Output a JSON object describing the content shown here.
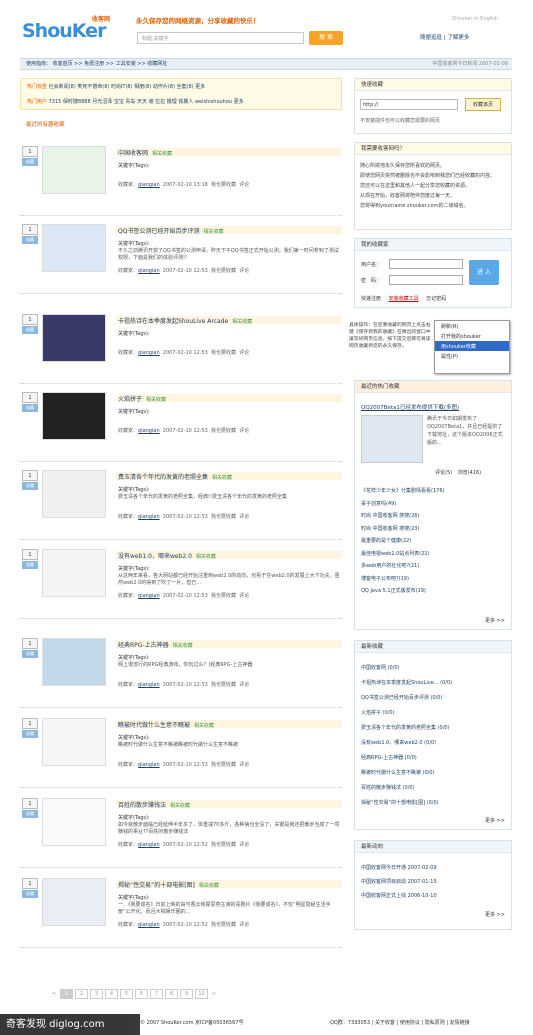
{
  "header": {
    "logo_text": "ShouKer",
    "logo_cn": "收客网",
    "slogan": "永久保存您的网络资源，分享收藏的快乐！",
    "search_placeholder": "标题,关键字",
    "search_btn": "搜 索",
    "english": "Shouker in English",
    "links": "随便逛逛 | 了解更多"
  },
  "nav": {
    "breadcrumb": "使用指南： 收客首页 >> 免费注册 >> 工具安装 >> 收藏网址",
    "right": "中国收客网今日新闻 2007-02-09"
  },
  "tags": {
    "hot_label": "热门标签",
    "hot": "社会新闻(8) 笑死不偿命(8) 时尚IT(8) 相册(8) 动作片(8) 全套(8) 更多",
    "users_label": "热门用户",
    "users": "7315 保时捷8888 月光沼泽 宝宝 青岛 天天 谢 拉拉 摄理 铁翼人 weishishouhou 更多"
  },
  "recent": {
    "title": "最近的有趣收藏"
  },
  "items": [
    {
      "count": "1",
      "badge": "收藏",
      "title": "中国收客网",
      "rel": "相关收藏",
      "kw": "关键字(Tags):",
      "desc": "",
      "user": "qiangian",
      "date": "2007-02-10 13:18",
      "a1": "我也要收藏",
      "a2": "评论"
    },
    {
      "count": "1",
      "badge": "收藏",
      "title": "QQ书签公测已经开始百步评测",
      "rel": "相关收藏",
      "kw": "关键字(Tags):",
      "desc": "不久之前腾讯开放了QQ书签的公测申请，昨天下午QQ书签正式开始公测，我们第一时间拿到了测试权限，下面是我们的体验评测!!",
      "user": "qiangian",
      "date": "2007-02-10 12:53",
      "a1": "我也要收藏",
      "a2": "评论"
    },
    {
      "count": "1",
      "badge": "收藏",
      "title": "卡祖热诗在本季度发起ShouLive Arcade",
      "rel": "相关收藏",
      "kw": "关键字(Tags):",
      "desc": "",
      "user": "qiangian",
      "date": "2007-02-10 12:53",
      "a1": "我也要收藏",
      "a2": "评论"
    },
    {
      "count": "1",
      "badge": "收藏",
      "title": "火焰拼子",
      "rel": "相关收藏",
      "kw": "关键字(Tags):",
      "desc": "",
      "user": "qiangian",
      "date": "2007-02-10 12:53",
      "a1": "我也要收藏",
      "a2": "评论"
    },
    {
      "count": "1",
      "badge": "收藏",
      "title": "费玉清各个年代的发黄的老照全集",
      "rel": "相关收藏",
      "kw": "关键字(Tags):",
      "desc": "费玉清各个年代的发黄的老照全集，经典!!费玉清各个年代的发黄的老照全集",
      "user": "qiangian",
      "date": "2007-02-10 12:53",
      "a1": "我也要收藏",
      "a2": "评论"
    },
    {
      "count": "1",
      "badge": "收藏",
      "title": "没有web1.0，哪来web2.0",
      "rel": "相关收藏",
      "kw": "关键字(Tags):",
      "desc": "从这两年来看，各大网站都已经开始注重到web2.0的动向，也看于在web2.0的发展上大下功夫。虽然web2.0的得到了吹了一片，但已...",
      "user": "qiangian",
      "date": "2007-02-10 12:53",
      "a1": "我也要收藏",
      "a2": "评论"
    },
    {
      "count": "1",
      "badge": "收藏",
      "title": "经典RPG-上古神器",
      "rel": "相关收藏",
      "kw": "关键字(Tags):",
      "desc": "网上很流行的RPG经典游戏，你玩过么？)经典RPG-上古神器",
      "user": "qiangian",
      "date": "2007-02-10 12:53",
      "a1": "我也要收藏",
      "a2": "评论"
    },
    {
      "count": "1",
      "badge": "收藏",
      "title": "瞧被时代做什么生意不瞧被",
      "rel": "相关收藏",
      "kw": "关键字(Tags):",
      "desc": "瞧被时代做什么生意不瞧被瞧被时代做什么生意不瞧被",
      "user": "qiangian",
      "date": "2007-02-10 12:53",
      "a1": "我也要收藏",
      "a2": "评论"
    },
    {
      "count": "1",
      "badge": "收藏",
      "title": "百姓的散步赚钱法",
      "rel": "相关收藏",
      "kw": "关键字(Tags):",
      "desc": "如今就散步面临已经延伸半年多了，体重减70多斤，各种病也全没了，关键是我还把散步当成了一项赚钱的事业??百姓的散步赚钱法",
      "user": "qiangian",
      "date": "2007-02-10 12:52",
      "a1": "我也要收藏",
      "a2": "评论"
    },
    {
      "count": "1",
      "badge": "收藏",
      "title": "揭秘“性交易”的十部电影[图]",
      "rel": "相关收藏",
      "kw": "关键字(Tags):",
      "desc": "一、《我要成名》日前上映的由与香云和霍思燕主演的喜剧片《我要成名》，不仅“明星隐秘生活手册”公开化，而且大揭娱乐圈的...",
      "user": "qiangian",
      "date": "2007-02-10 12:52",
      "a1": "我也要收藏",
      "a2": "评论"
    }
  ],
  "side": {
    "quick": {
      "title": "快速收藏",
      "input": "http://",
      "btn": "收藏该页",
      "note": "不安装插件也可以收藏您需要的网页"
    },
    "why": {
      "title": "我需要收客网吗？",
      "lines": [
        "随心所欲地永久保存您所喜欢的网页。",
        "即使您网页突然被删除也不会影响到我您们已经收藏的内容。",
        "您还可以在这里和其他人一起分享您收藏的资源。",
        "从现在开始，收客网将陪伴您度过每一天。",
        "您将得到yourname.shouker.com的二级域名。"
      ]
    },
    "login": {
      "title": "我的收藏家",
      "user_label": "用户名：",
      "pass_label": "密　码：",
      "btn": "进 入",
      "reg": "快速注册",
      "install": "安装收藏工具",
      "forget": "忘记密码"
    },
    "tip": "具体操作：在您要收藏的网页上点击右键《保存到我的收藏》在弹出的窗口中填写好网页信息，按下提交后即可将该网页收藏到您的永久保存。",
    "ctx": [
      "刷新(R)",
      "打开我的shouker",
      "用shouker收藏",
      "属性(P)"
    ],
    "hot": {
      "title": "最近的热门收藏",
      "first_title": "QQ2007Beta1已经发布提供下载(多图)",
      "first_desc": "腾讯于今日如期发布了QQ2007Beta1，并且已经提供了下载地址，这个版本QQ2006正式版的...",
      "first_c": "评论(5)",
      "first_d": "浏览(416)",
      "list": [
        "《花样少年少女》分集剧情看看(176)",
        "桌子创意吗(49)",
        "时尚 中国收客网 搜搜(26)",
        "时尚 中国收客网 搜搜(23)",
        "最重要的是个健康(22)",
        "最佳电视web2.0站点列表(22)",
        "多web用户的社化吧?(21)",
        "博客电子公布吧?(19)",
        "QQ Java 5.1正式版发布(19)"
      ],
      "more": "更多 >>"
    },
    "newest": {
      "title": "最新收藏",
      "list": [
        "中国收客网 (0/0)",
        "卡祖热诗在本季度发起ShouLive... (0/0)",
        "QQ书签公测已经开始百步评测 (0/0)",
        "火焰拼子 (0/0)",
        "费玉清各个年代的发黄的老照全集 (0/0)",
        "没有web1.0，哪来web2.0 (0/0)",
        "经典RPG-上古神器 (0/0)",
        "瞧被时代做什么生意不瞧被 (0/0)",
        "百姓的散步赚钱法 (0/0)",
        "揭秘“性交易”的十部电影[图] (0/0)"
      ],
      "more": "更多 >>"
    },
    "news": {
      "title": "最新动向",
      "list": [
        "中国收客网今日开通 2007-02-09",
        "中国收客网项目启动 2007-01-15",
        "中国收客网正式上线 2006-10-10"
      ],
      "more": "更多 >>"
    }
  },
  "pager": [
    "<",
    "1",
    "2",
    "3",
    "4",
    "5",
    "6",
    "7",
    "8",
    "9",
    "10",
    ">"
  ],
  "footer": {
    "copy": "© 2007 ShouKer.com 京ICP备05036567号",
    "links": "QQ群：7333053 | 关于收客 | 使用协议 | 隐私原则 | 友情链接",
    "watermark": "奇客发现 diglog.com"
  }
}
